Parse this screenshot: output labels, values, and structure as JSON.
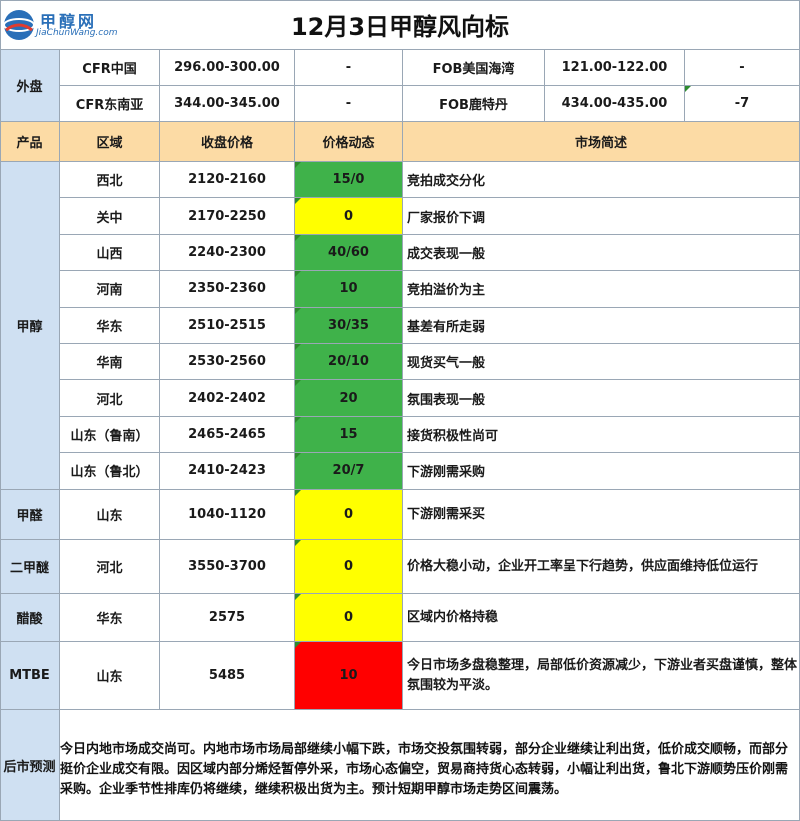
{
  "title": "12月3日甲醇风向标",
  "logo": {
    "name": "甲醇网",
    "site": "JiaChunWang.com"
  },
  "colors": {
    "blue_label": "#cfe0f2",
    "header": "#fcdba5",
    "up": "#3fb24a",
    "flat": "#ffff00",
    "down": "#ff0000"
  },
  "outer": {
    "label": "外盘",
    "rows": [
      {
        "name1": "CFR中国",
        "price1": "296.00-300.00",
        "change1": "-",
        "name2": "FOB美国海湾",
        "price2": "121.00-122.00",
        "change2": "-"
      },
      {
        "name1": "CFR东南亚",
        "price1": "344.00-345.00",
        "change1": "-",
        "name2": "FOB鹿特丹",
        "price2": "434.00-435.00",
        "change2": "-7"
      }
    ]
  },
  "headers": {
    "product": "产品",
    "region": "区域",
    "close": "收盘价格",
    "dynamic": "价格动态",
    "desc": "市场简述"
  },
  "methanol": {
    "label": "甲醇",
    "rows": [
      {
        "region": "西北",
        "price": "2120-2160",
        "dynamic": "15/0",
        "status": "up",
        "desc": "竞拍成交分化"
      },
      {
        "region": "关中",
        "price": "2170-2250",
        "dynamic": "0",
        "status": "flat",
        "desc": "厂家报价下调"
      },
      {
        "region": "山西",
        "price": "2240-2300",
        "dynamic": "40/60",
        "status": "up",
        "desc": "成交表现一般"
      },
      {
        "region": "河南",
        "price": "2350-2360",
        "dynamic": "10",
        "status": "up",
        "desc": "竞拍溢价为主"
      },
      {
        "region": "华东",
        "price": "2510-2515",
        "dynamic": "30/35",
        "status": "up",
        "desc": "基差有所走弱"
      },
      {
        "region": "华南",
        "price": "2530-2560",
        "dynamic": "20/10",
        "status": "up",
        "desc": "现货买气一般"
      },
      {
        "region": "河北",
        "price": "2402-2402",
        "dynamic": "20",
        "status": "up",
        "desc": "氛围表现一般"
      },
      {
        "region": "山东（鲁南）",
        "price": "2465-2465",
        "dynamic": "15",
        "status": "up",
        "desc": "接货积极性尚可"
      },
      {
        "region": "山东（鲁北）",
        "price": "2410-2423",
        "dynamic": "20/7",
        "status": "up",
        "desc": "下游刚需采购"
      }
    ]
  },
  "others": [
    {
      "product": "甲醛",
      "region": "山东",
      "price": "1040-1120",
      "dynamic": "0",
      "status": "flat",
      "desc": "下游刚需采买"
    },
    {
      "product": "二甲醚",
      "region": "河北",
      "price": "3550-3700",
      "dynamic": "0",
      "status": "flat",
      "desc": "价格大稳小动，企业开工率呈下行趋势，供应面维持低位运行"
    },
    {
      "product": "醋酸",
      "region": "华东",
      "price": "2575",
      "dynamic": "0",
      "status": "flat",
      "desc": "区域内价格持稳"
    },
    {
      "product": "MTBE",
      "region": "山东",
      "price": "5485",
      "dynamic": "10",
      "status": "down",
      "desc": "今日市场多盘稳整理，局部低价资源减少，下游业者买盘谨慎，整体氛围较为平淡。"
    }
  ],
  "forecast": {
    "label": "后市预测",
    "text": "今日内地市场成交尚可。内地市场市场局部继续小幅下跌，市场交投氛围转弱，部分企业继续让利出货，低价成交顺畅，而部分挺价企业成交有限。因区域内部分烯烃暂停外采，市场心态偏空，贸易商持货心态转弱，小幅让利出货，鲁北下游顺势压价刚需采购。企业季节性排库仍将继续，继续积极出货为主。预计短期甲醇市场走势区间震荡。"
  }
}
